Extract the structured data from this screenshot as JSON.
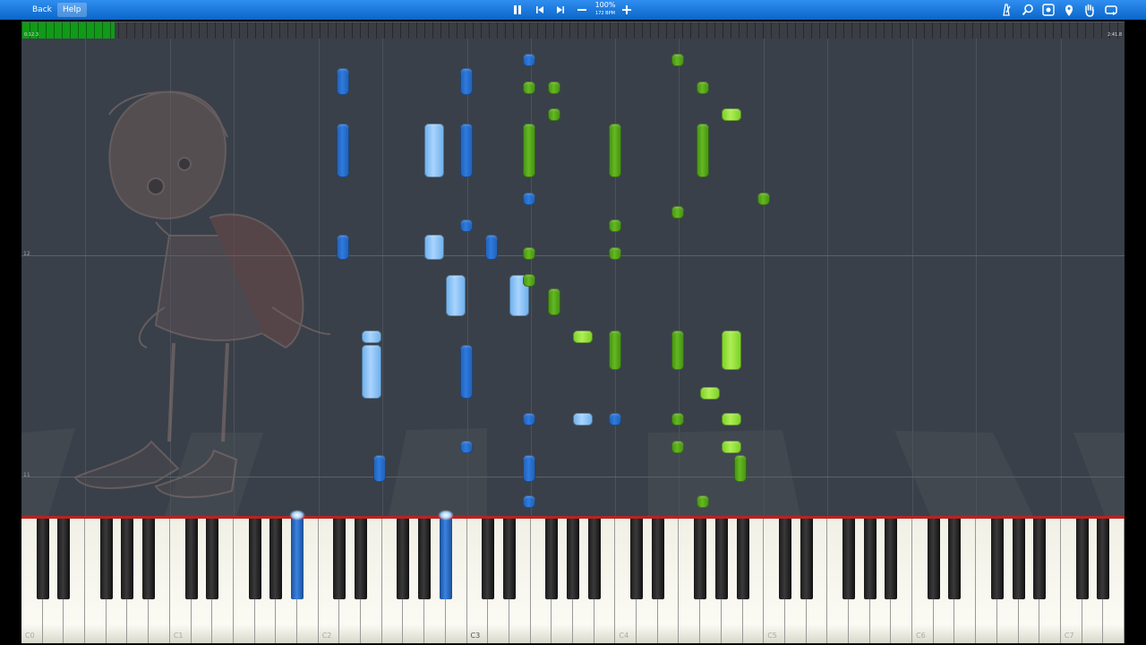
{
  "toolbar": {
    "back_label": "Back",
    "help_label": "Help",
    "speed_percent": "100%",
    "speed_bpm": "172 BPM",
    "playback_icons": [
      "pause-icon",
      "skip-back-icon",
      "skip-forward-icon",
      "minus-icon",
      "plus-icon"
    ],
    "tool_icons": [
      "metronome-icon",
      "search-icon",
      "settings-icon",
      "location-icon",
      "hand-icon",
      "loop-icon"
    ]
  },
  "progress": {
    "current_time": "0:12.3",
    "total_time": "2:41.8",
    "fraction": 0.0845
  },
  "roll": {
    "measures": [
      {
        "label": "12"
      },
      {
        "label": "11"
      }
    ]
  },
  "keyboard": {
    "octave_labels": [
      "C0",
      "C1",
      "C2",
      "C3",
      "C4",
      "C5",
      "C6",
      "C7"
    ]
  },
  "colors": {
    "toolbar": "#1a78e0",
    "progress_fill": "#109a18",
    "left_hand": "#2f7be0",
    "right_hand": "#66b821",
    "hit_line": "#b22222",
    "roll_background": "#394049"
  }
}
